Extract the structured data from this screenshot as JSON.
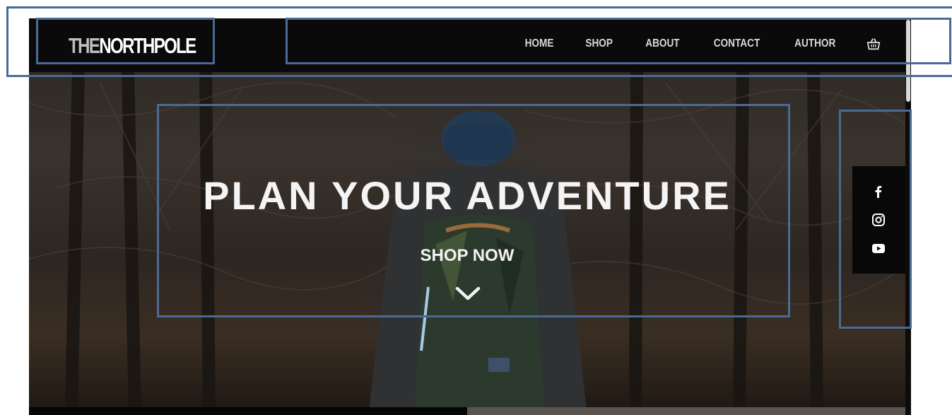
{
  "logo": {
    "prefix": "THE",
    "name": "NORTHPOLE"
  },
  "nav": {
    "links": [
      {
        "label": "HOME"
      },
      {
        "label": "SHOP"
      },
      {
        "label": "ABOUT"
      },
      {
        "label": "CONTACT"
      },
      {
        "label": "AUTHOR"
      }
    ],
    "cart_icon": "shopping-basket-icon"
  },
  "hero": {
    "title": "PLAN YOUR ADVENTURE",
    "cta_label": "SHOP NOW",
    "scroll_icon": "chevron-down-icon"
  },
  "social": {
    "icons": [
      "facebook-icon",
      "instagram-icon",
      "youtube-icon"
    ]
  },
  "colors": {
    "annotation": "#4a6a96",
    "navbar": "#0b0a0a",
    "text": "#f4f4f4"
  }
}
